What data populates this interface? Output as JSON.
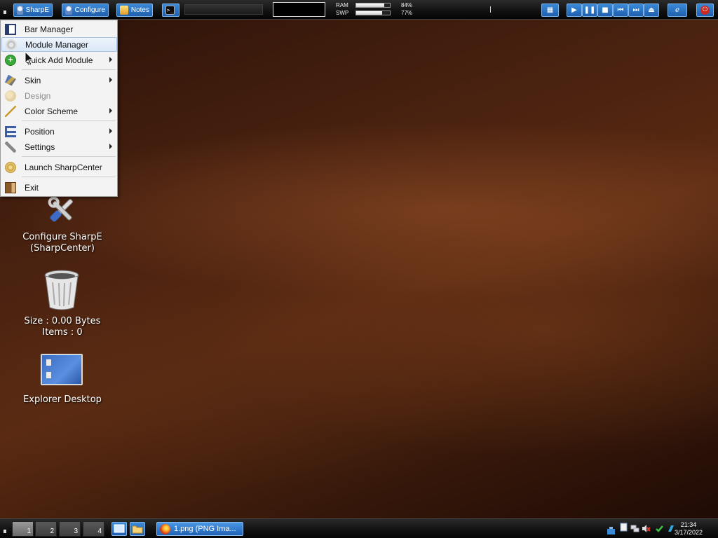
{
  "topbar": {
    "buttons": [
      {
        "label": "SharpE",
        "icon": "user-icon"
      },
      {
        "label": "Configure",
        "icon": "configure-icon"
      },
      {
        "label": "Notes",
        "icon": "notes-icon"
      },
      {
        "label": "",
        "icon": "terminal-icon"
      }
    ],
    "meters": [
      {
        "label": "RAM",
        "value": "84%",
        "fill": 0.84
      },
      {
        "label": "SWP",
        "value": "77%",
        "fill": 0.77
      }
    ],
    "media_controls": [
      "play-icon",
      "pause-icon",
      "stop-icon",
      "previous-icon",
      "next-icon"
    ],
    "accent_color": "#2a72c4"
  },
  "menu": {
    "items": [
      {
        "label": "Bar Manager",
        "icon": "bar-manager-icon",
        "submenu": false,
        "disabled": false
      },
      {
        "label": "Module Manager",
        "icon": "module-manager-icon",
        "submenu": false,
        "disabled": false,
        "highlighted": true
      },
      {
        "label": "Quick Add Module",
        "icon": "add-icon",
        "submenu": true,
        "disabled": false
      },
      {
        "label": "Skin",
        "icon": "skin-icon",
        "submenu": true,
        "disabled": false
      },
      {
        "label": "Design",
        "icon": "design-icon",
        "submenu": false,
        "disabled": true
      },
      {
        "label": "Color Scheme",
        "icon": "color-scheme-icon",
        "submenu": true,
        "disabled": false
      },
      {
        "label": "Position",
        "icon": "position-icon",
        "submenu": true,
        "disabled": false
      },
      {
        "label": "Settings",
        "icon": "settings-icon",
        "submenu": true,
        "disabled": false
      },
      {
        "label": "Launch SharpCenter",
        "icon": "launch-icon",
        "submenu": false,
        "disabled": false
      },
      {
        "label": "Exit",
        "icon": "exit-icon",
        "submenu": false,
        "disabled": false
      }
    ]
  },
  "desktop": {
    "icons": [
      {
        "line1": "Configure SharpE",
        "line2": "(SharpCenter)",
        "icon": "tools-icon"
      },
      {
        "line1": "Size : 0.00 Bytes",
        "line2": "Items : 0",
        "icon": "recycle-bin-icon"
      },
      {
        "line1": "Explorer Desktop",
        "line2": "",
        "icon": "explorer-desktop-icon"
      }
    ]
  },
  "bottombar": {
    "workspaces": [
      "1",
      "2",
      "3",
      "4"
    ],
    "active_workspace": "1",
    "task_label": "1.png (PNG Ima...",
    "clock_time": "21:34",
    "clock_date": "3/17/2022"
  }
}
